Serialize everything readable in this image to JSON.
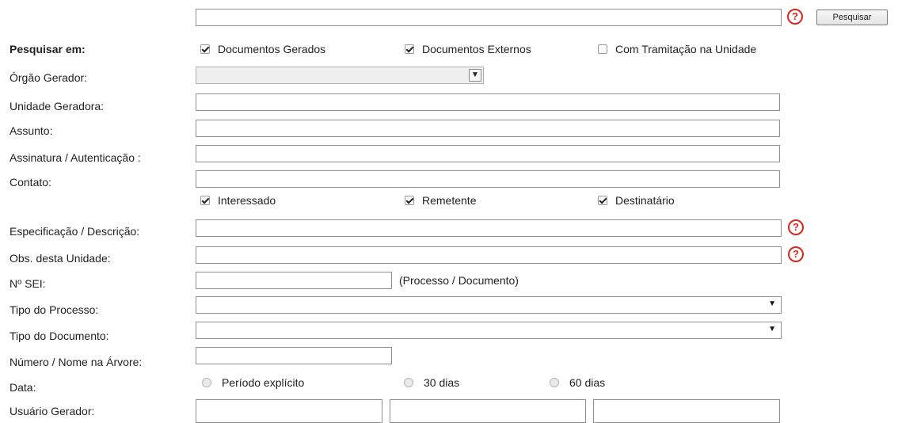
{
  "search": {
    "button_label": "Pesquisar",
    "help_icon": "question-circle-icon"
  },
  "labels": {
    "pesquisar_em": "Pesquisar em:",
    "orgao_gerador": "Órgão Gerador:",
    "unidade_geradora": "Unidade Geradora:",
    "assunto": "Assunto:",
    "assinatura": "Assinatura / Autenticação :",
    "contato": "Contato:",
    "especificacao": "Especificação / Descrição:",
    "obs": "Obs. desta Unidade:",
    "n_sei": "Nº SEI:",
    "tipo_processo": "Tipo do Processo:",
    "tipo_documento": "Tipo do Documento:",
    "numero_nome": "Número / Nome na Árvore:",
    "data": "Data:",
    "usuario_gerador": "Usuário Gerador:"
  },
  "scope_checks": [
    {
      "label": "Documentos Gerados",
      "checked": true
    },
    {
      "label": "Documentos Externos",
      "checked": true
    },
    {
      "label": "Com Tramitação na Unidade",
      "checked": false
    }
  ],
  "contact_checks": [
    {
      "label": "Interessado",
      "checked": true
    },
    {
      "label": "Remetente",
      "checked": true
    },
    {
      "label": "Destinatário",
      "checked": true
    }
  ],
  "sei_hint": "(Processo / Documento)",
  "date_options": [
    {
      "label": "Período explícito"
    },
    {
      "label": "30 dias"
    },
    {
      "label": "60 dias"
    }
  ],
  "colors": {
    "help_red": "#d9261c"
  }
}
